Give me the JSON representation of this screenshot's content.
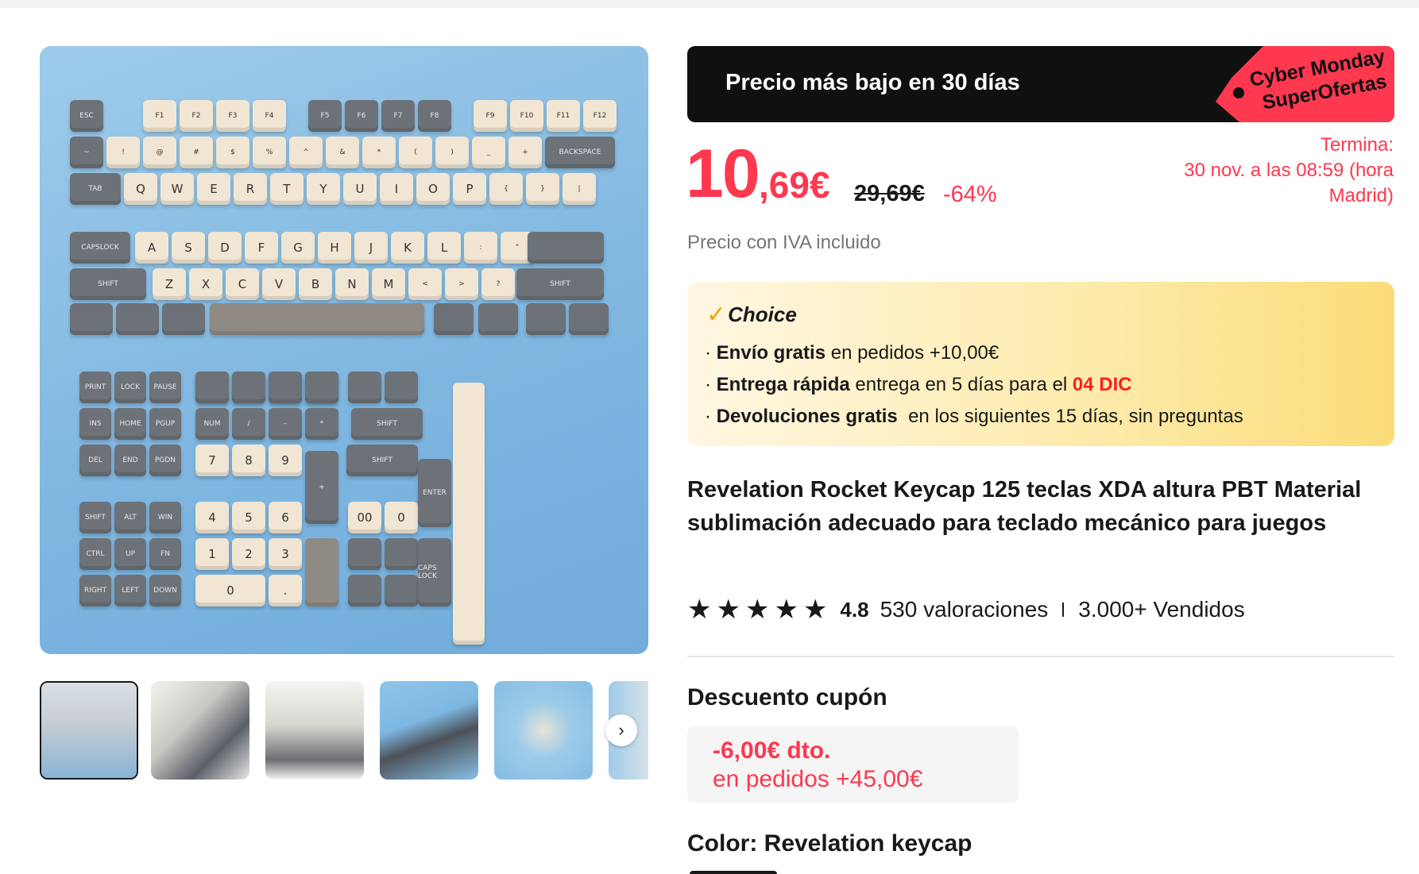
{
  "promo": {
    "banner_text": "Precio más bajo en 30 días",
    "tag_line1": "Cyber Monday",
    "tag_line2": "SuperOfertas",
    "tag_color": "#fd384f"
  },
  "price": {
    "integer": "10",
    "decimal": ",69€",
    "original": "29,69€",
    "discount": "-64%",
    "ends_label": "Termina:",
    "ends_value": "30 nov. a las 08:59 (hora Madrid)",
    "tax_note": "Precio con IVA incluido",
    "accent_color": "#fd384f"
  },
  "choice": {
    "title": "Choice",
    "lines": [
      {
        "bold": "Envío gratis",
        "text": " en pedidos +10,00€"
      },
      {
        "bold": "Entrega rápida",
        "text": " entrega en 5 días para el ",
        "date": "04 DIC"
      },
      {
        "bold": "Devoluciones gratis",
        "text": "  en los siguientes 15 días, sin preguntas"
      }
    ]
  },
  "product": {
    "title": "Revelation Rocket Keycap 125 teclas XDA altura PBT Material sublimación adecuado para teclado mecánico para juegos",
    "rating": "4.8",
    "reviews": "530 valoraciones",
    "sold": "3.000+ Vendidos"
  },
  "coupon": {
    "heading": "Descuento cupón",
    "amount": "-6,00€ dto.",
    "condition": "en pedidos +45,00€"
  },
  "color": {
    "label": "Color: Revelation keycap"
  },
  "gallery": {
    "thumbnails": [
      "keycap-set-image",
      "keyboard-angle-image",
      "keyboard-closeup-image",
      "keyboard-blue-image",
      "loose-keycaps-image",
      "keycaps-partial-image"
    ],
    "next_icon": "chevron-right-icon"
  },
  "keys": {
    "fn_row": [
      "ESC",
      "F1",
      "F2",
      "F3",
      "F4",
      "F5",
      "F6",
      "F7",
      "F8",
      "F9",
      "F10",
      "F11",
      "F12"
    ],
    "num_row": [
      "~",
      "!",
      "@",
      "#",
      "$",
      "%",
      "^",
      "&",
      "*",
      "(",
      ")",
      "_",
      "+",
      "BACKSPACE"
    ],
    "qwerty_row": [
      "TAB",
      "Q",
      "W",
      "E",
      "R",
      "T",
      "Y",
      "U",
      "I",
      "O",
      "P",
      "{",
      "}",
      "|"
    ],
    "home_row": [
      "CAPSLOCK",
      "A",
      "S",
      "D",
      "F",
      "G",
      "H",
      "J",
      "K",
      "L",
      ":",
      "\"",
      ""
    ],
    "shift_row": [
      "SHIFT",
      "Z",
      "X",
      "C",
      "V",
      "B",
      "N",
      "M",
      "<",
      ">",
      "?",
      "SHIFT"
    ],
    "nav_row1": [
      "PRINT",
      "LOCK",
      "PAUSE"
    ],
    "nav_row2": [
      "INS",
      "HOME",
      "PGUP"
    ],
    "nav_row3": [
      "DEL",
      "END",
      "PGDN"
    ],
    "nav_row4": [
      "SHIFT",
      "ALT",
      "WIN"
    ],
    "nav_row5": [
      "CTRL",
      "UP",
      "FN"
    ],
    "nav_row6": [
      "RIGHT",
      "LEFT",
      "DOWN"
    ],
    "numpad_row1": [
      "NUM",
      "/",
      "–",
      "*"
    ],
    "numpad_row2": [
      "7",
      "8",
      "9"
    ],
    "numpad_row3": [
      "4",
      "5",
      "6"
    ],
    "numpad_row4": [
      "1",
      "2",
      "3"
    ],
    "numpad_row5": [
      "0",
      "."
    ],
    "extra": [
      "00",
      "0",
      "SHIFT",
      "SHIFT",
      "ENTER",
      "ENTER",
      "+",
      "CAPS LOCK"
    ]
  }
}
